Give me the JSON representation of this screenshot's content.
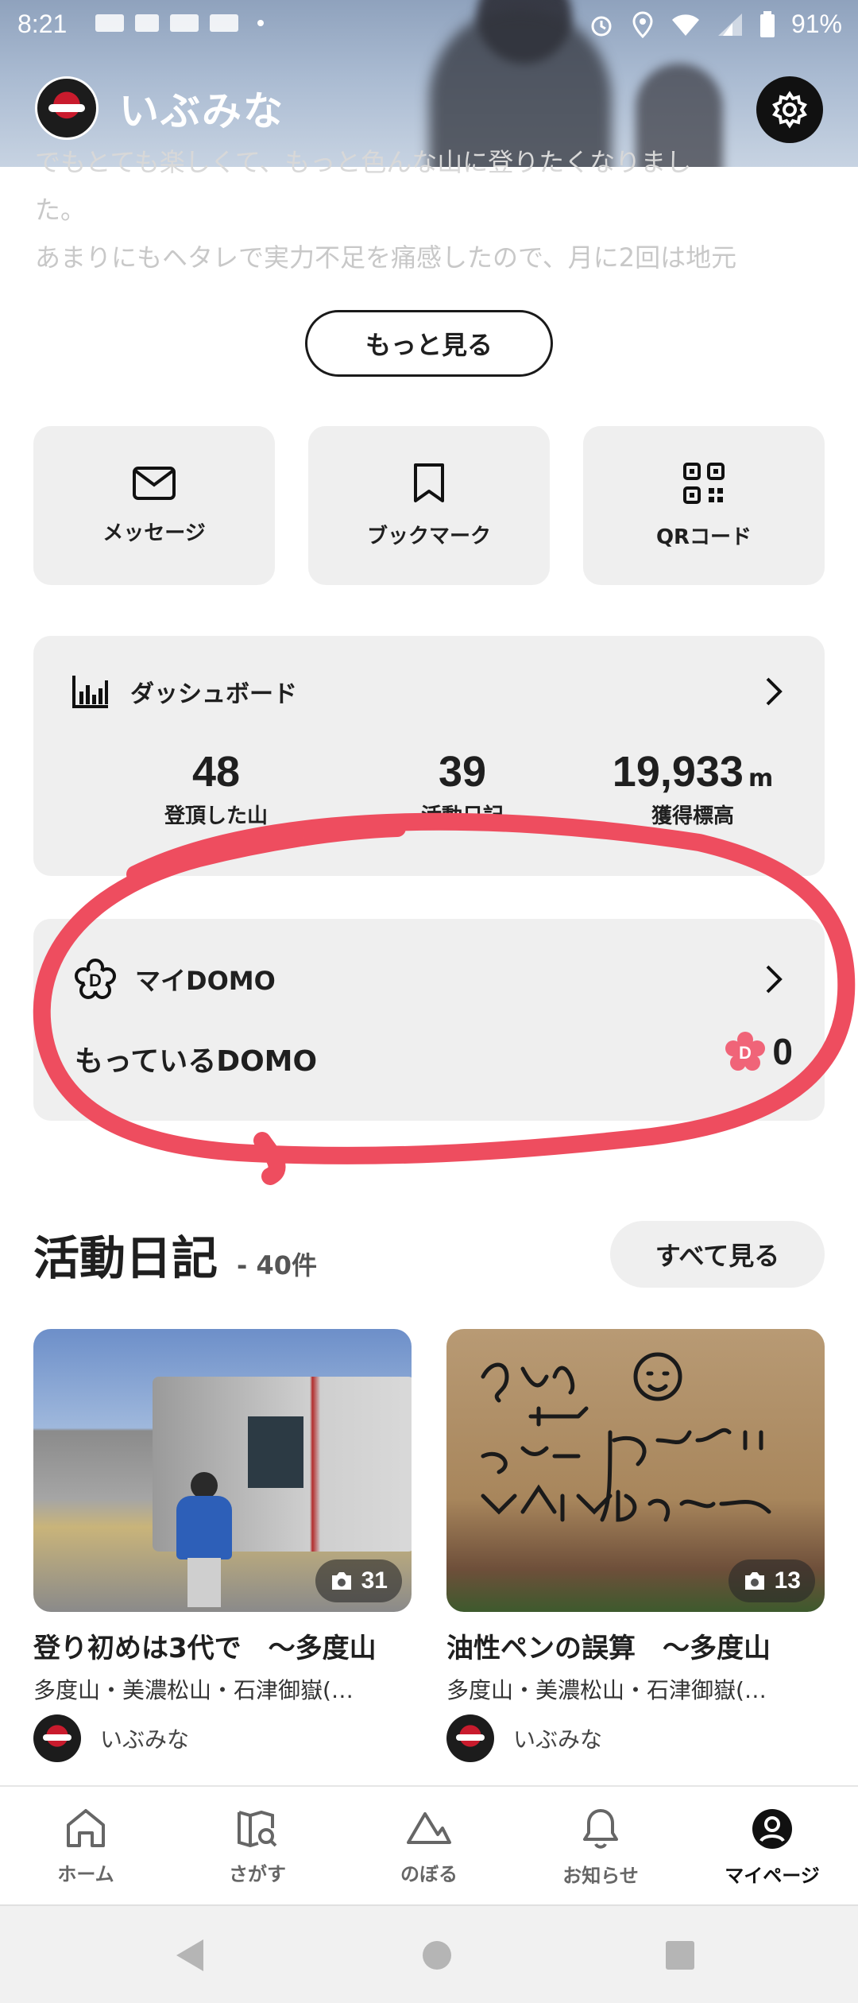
{
  "status_bar": {
    "time": "8:21",
    "battery": "91%",
    "icons": [
      "smartnews-icon",
      "gallery-icon",
      "smartnews-icon",
      "smartnews-icon",
      "alarm-icon",
      "location-icon",
      "wifi-icon",
      "signal-icon",
      "battery-icon"
    ]
  },
  "profile": {
    "name": "いぶみな",
    "settings_icon": "gear-icon"
  },
  "bio": {
    "lines": [
      "でもとても楽しくて、もっと色んな山に登りたくなりまし",
      "た。",
      "あまりにもヘタレで実力不足を痛感したので、月に2回は地元"
    ],
    "more_button": "もっと見る"
  },
  "quick_actions": [
    {
      "label": "メッセージ",
      "icon": "envelope-icon"
    },
    {
      "label": "ブックマーク",
      "icon": "bookmark-icon"
    },
    {
      "label": "QRコード",
      "icon": "qr-code-icon"
    }
  ],
  "dashboard": {
    "title": "ダッシュボード",
    "stats": [
      {
        "value": "48",
        "unit": "",
        "caption": "登頂した山"
      },
      {
        "value": "39",
        "unit": "",
        "caption": "活動日記"
      },
      {
        "value": "19,933",
        "unit": "m",
        "caption": "獲得標高"
      }
    ]
  },
  "domo": {
    "title": "マイDOMO",
    "subtitle": "もっているDOMO",
    "count": "0"
  },
  "diary": {
    "title": "活動日記",
    "count": "- 40件",
    "see_all": "すべて見る",
    "entries": [
      {
        "title": "登り初めは3代で　～多度山",
        "mountains": "多度山・美濃松山・石津御嶽(…",
        "author": "いぶみな",
        "photo_count": "31"
      },
      {
        "title": "油性ペンの誤算　～多度山",
        "mountains": "多度山・美濃松山・石津御嶽(…",
        "author": "いぶみな",
        "photo_count": "13"
      }
    ]
  },
  "bottom_nav": [
    {
      "label": "ホーム",
      "icon": "home-icon",
      "active": false
    },
    {
      "label": "さがす",
      "icon": "map-search-icon",
      "active": false
    },
    {
      "label": "のぼる",
      "icon": "mountain-icon",
      "active": false
    },
    {
      "label": "お知らせ",
      "icon": "bell-icon",
      "active": false
    },
    {
      "label": "マイページ",
      "icon": "person-icon",
      "active": true
    }
  ],
  "colors": {
    "annotation": "#ee4d5f",
    "card_bg": "#efefef",
    "domo_pink": "#f06478"
  }
}
